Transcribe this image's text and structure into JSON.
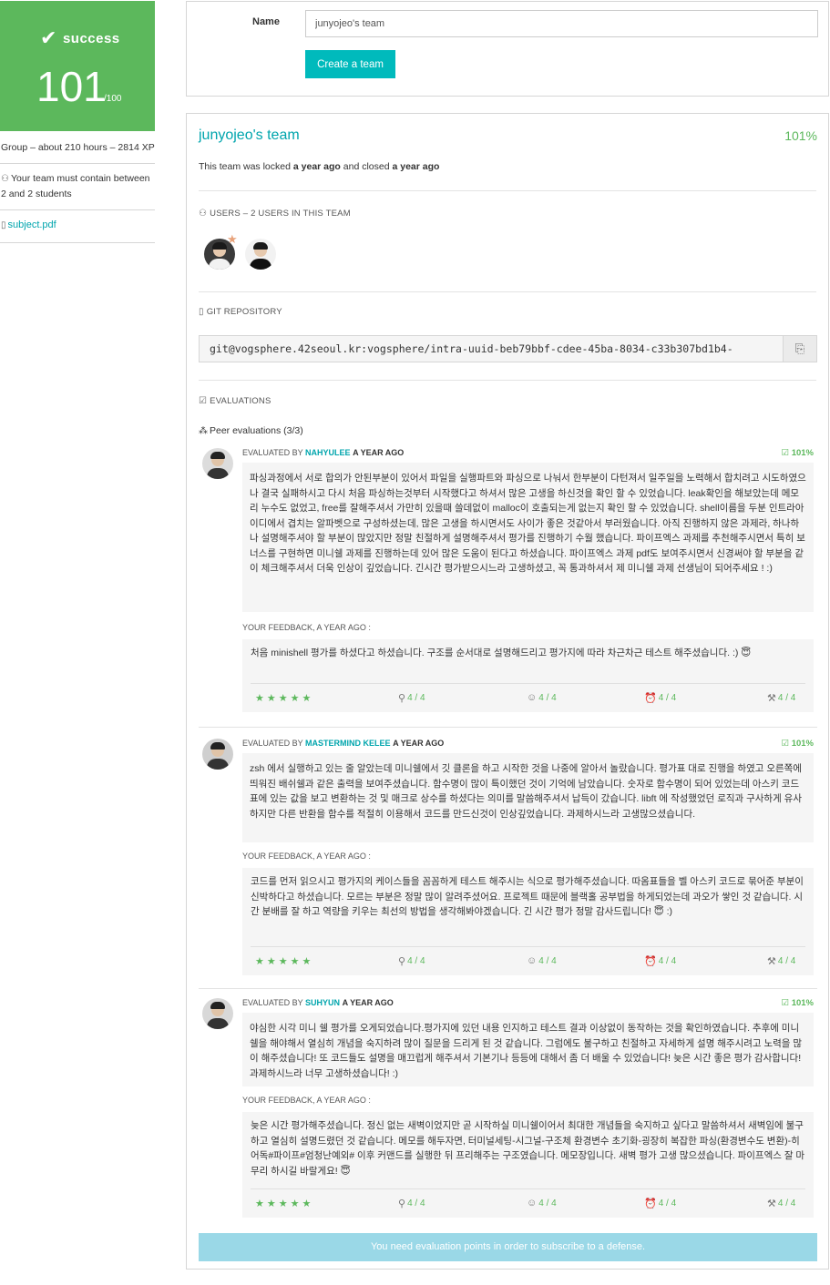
{
  "sidebar": {
    "status": "success",
    "score": "101",
    "score_max": "/100",
    "group_info": "Group – about 210 hours – 2814 XP",
    "team_rule": "Your team must contain between 2 and 2 students",
    "subject_link": "subject.pdf",
    "icons": {
      "status": "check-icon",
      "team_rule": "users-icon",
      "subject": "file-icon"
    }
  },
  "create_form": {
    "name_label": "Name",
    "name_value": "junyojeo's team",
    "create_button": "Create a team"
  },
  "team": {
    "title": "junyojeo's team",
    "percent": "101%",
    "lock_prefix": "This team was locked",
    "locked_when": "a year ago",
    "lock_middle": "and closed",
    "closed_when": "a year ago",
    "users_title": "USERS – 2 USERS IN THIS TEAM",
    "git_title": "GIT REPOSITORY",
    "git_url": "git@vogsphere.42seoul.kr:vogsphere/intra-uuid-beb79bbf-cdee-45ba-8034-c33b307bd1b4-",
    "evaluations_title": "EVALUATIONS",
    "peer_title": "Peer evaluations (3/3)",
    "notice": "You need evaluation points in order to subscribe to a defense.",
    "colors": {
      "accent": "#00babc",
      "success": "#5cb85c",
      "link": "#00a5ad",
      "notice": "#9ad8e7"
    }
  },
  "evaluations": [
    {
      "prefix": "EVALUATED BY",
      "evaluator": "NAHYULEE",
      "when": "A YEAR AGO",
      "score": "101%",
      "comment": "파싱과정에서 서로 합의가 안된부분이 있어서 파일을 실행파트와 파싱으로 나눠서 한부분이 다턴져서 일주일을 노력해서 합치려고 시도하였으나 결국 실패하시고 다시 처음 파싱하는것부터 시작했다고 하셔서 많은 고생을 하신것을 확인 할 수 있었습니다. leak확인을 해보았는데 메모리 누수도 없었고, free를 잘해주셔서 가만히 있을때 쓸데없이 malloc이 호출되는게 없는지 확인 할 수 있었습니다. shell이름을 두분 인트라아이디에서 겹치는 알파벳으로 구성하셨는데, 많은 고생을 하시면서도 사이가 좋은 것같아서 부러웠습니다. 아직 진행하지 않은 과제라, 하나하나 설명해주셔야 할 부분이 많았지만 정말 친절하게 설명해주셔서 평가를 진행하기 수월 했습니다. 파이프엑스 과제를 추천해주시면서 특히 보너스를 구현하면 미니쉘 과제를 진행하는데 있어 많은 도움이 된다고 하셨습니다. 파이프엑스 과제 pdf도 보여주시면서 신경써야 할 부분을 같이 체크해주셔서 더욱 인상이 깊었습니다. 긴시간 평가받으시느라 고생하셨고, 꼭 통과하셔서 제 미니쉘 과제 선생님이 되어주세요 ! :)",
      "feedback_label": "YOUR FEEDBACK, A YEAR AGO :",
      "feedback": "처음 minishell 평가를 하셨다고 하셨습니다. 구조를 순서대로 설명해드리고 평가지에 따라 차근차근 테스트 해주셨습니다. :) 😇",
      "ratings": {
        "stars": "★★★★★",
        "interested": "4 / 4",
        "nice": "4 / 4",
        "punctuality": "4 / 4",
        "rigorous": "4 / 4"
      }
    },
    {
      "prefix": "EVALUATED BY",
      "evaluator": "MASTERMIND KELEE",
      "when": "A YEAR AGO",
      "score": "101%",
      "comment": "zsh 에서 실행하고 있는 줄 알았는데 미니쉘에서 깃 클론을 하고 시작한 것을 나중에 알아서 놀랐습니다. 평가표 대로 진행을 하였고 오른쪽에 띄워진 배쉬쉘과 같은 출력을 보여주셨습니다. 함수명이 많이 특이했던 것이 기억에 남았습니다. 숫자로 함수명이 되어 있었는데 아스키 코드 표에 있는 값을 보고 변환하는 것 및 매크로 상수를 하셨다는 의미를 말씀해주셔서 납득이 갔습니다. libft 에 작성했었던 로직과 구사하게 유사하지만 다른 반환을 함수를 적절히 이용해서 코드를 만드신것이 인상깊었습니다. 과제하시느라 고생많으셨습니다.",
      "feedback_label": "YOUR FEEDBACK, A YEAR AGO :",
      "feedback": "코드를 먼저 읽으시고 평가지의 케이스들을 꼼꼼하게 테스트 해주시는 식으로 평가해주셨습니다. 따옴표들을 벨 아스키 코드로 묶어준 부분이 신박하다고 하셨습니다. 모르는 부분은 정말 많이 알려주셨어요. 프로젝트 때문에 블랙홀 공부법을 하게되었는데 과오가 쌓인 것 같습니다. 시간 분배를 잘 하고 역량을 키우는 최선의 방법을 생각해봐야겠습니다. 긴 시간 평가 정말 감사드립니다! 😇 :)",
      "ratings": {
        "stars": "★★★★★",
        "interested": "4 / 4",
        "nice": "4 / 4",
        "punctuality": "4 / 4",
        "rigorous": "4 / 4"
      }
    },
    {
      "prefix": "EVALUATED BY",
      "evaluator": "SUHYUN",
      "when": "A YEAR AGO",
      "score": "101%",
      "comment": "야심한 시각 미니 쉘 평가를 오게되었습니다.평가지에 있던 내용 인지하고 테스트 결과 이상없이 동작하는 것을 확인하였습니다. 추후에 미니쉘을 해야해서 열심히 개념을 숙지하려 많이 질문을 드리게 된 것 같습니다. 그럼에도 불구하고 친절하고 자세하게 설명 해주시려고 노력을 많이 해주셨습니다! 또 코드들도 설명을 매끄럽게 해주셔서 기본기나 등등에 대해서 좀 더 배울 수 있었습니다! 늦은 시간 좋은 평가 감사합니다! 과제하시느라 너무 고생하셨습니다! :)",
      "feedback_label": "YOUR FEEDBACK, A YEAR AGO :",
      "feedback": "늦은 시간 평가해주셨습니다. 정신 없는 새벽이었지만 곧 시작하실 미니쉘이어서 최대한 개념들을 숙지하고 싶다고 말씀하셔서 새벽임에 불구하고 열심히 설명드렸던 것 같습니다. 메모를 해두자면, 터미널세팅-시그널-구조체 환경변수 초기화-굉장히 복잡한 파싱(환경변수도 변환)-히어독#파이프#엄청난예외# 이후 커맨드를 실행한 뒤 프리해주는 구조였습니다. 메모장입니다. 새벽 평가 고생 많으셨습니다. 파이프엑스 잘 마무리 하시길 바랄게요! 😇",
      "ratings": {
        "stars": "★★★★★",
        "interested": "4 / 4",
        "nice": "4 / 4",
        "punctuality": "4 / 4",
        "rigorous": "4 / 4"
      }
    }
  ]
}
